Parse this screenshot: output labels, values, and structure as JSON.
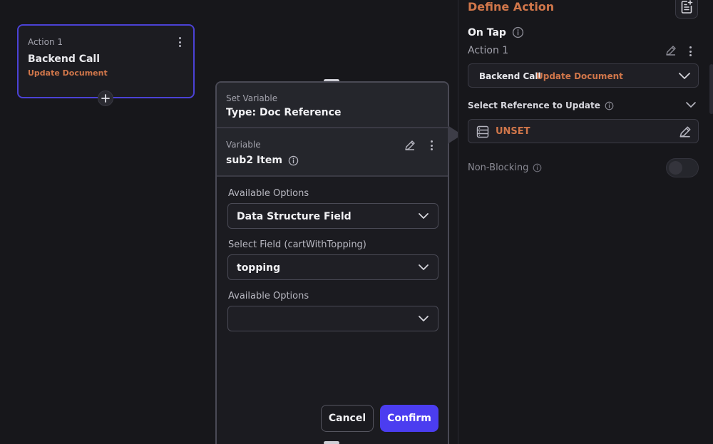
{
  "action_card": {
    "label": "Action 1",
    "title": "Backend Call",
    "subtitle": "Update Document"
  },
  "set_variable": {
    "header_label": "Set Variable",
    "header_title": "Type: Doc Reference",
    "variable_label": "Variable",
    "variable_value": "sub2 Item",
    "options_label_1": "Available Options",
    "options_value_1": "Data Structure Field",
    "field_label": "Select Field (cartWithTopping)",
    "field_value": "topping",
    "options_label_2": "Available Options",
    "options_value_2": "",
    "cancel_label": "Cancel",
    "confirm_label": "Confirm"
  },
  "right_panel": {
    "title": "Define Action",
    "on_tap": "On Tap",
    "action_label": "Action 1",
    "select_value_1": "Backend Call",
    "select_value_2": "Update Document",
    "ref_label": "Select Reference to Update",
    "unset_value": "UNSET",
    "non_blocking_label": "Non-Blocking",
    "non_blocking_on": false
  },
  "colors": {
    "accent": "#4b3df0",
    "orange": "#d0764a",
    "card_border": "#4b42d6"
  },
  "icons": [
    "more-vert-icon",
    "plus-icon",
    "edit-icon",
    "info-icon",
    "chevron-down-icon",
    "document-add-icon",
    "database-icon"
  ]
}
